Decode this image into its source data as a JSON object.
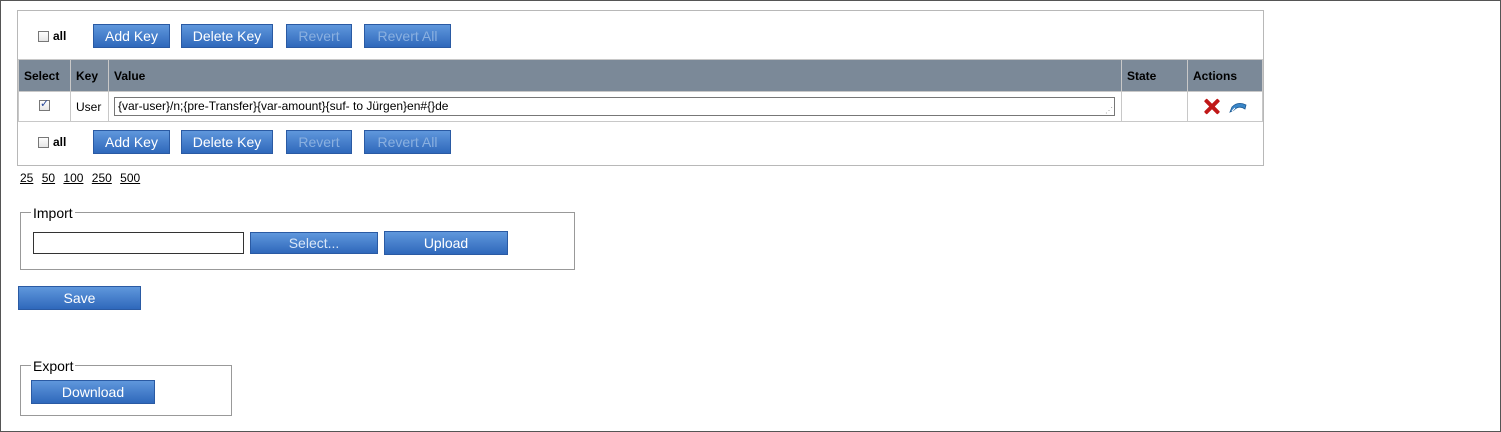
{
  "toolbar": {
    "all_label": "all",
    "add_key": "Add Key",
    "delete_key": "Delete Key",
    "revert": "Revert",
    "revert_all": "Revert All"
  },
  "table": {
    "headers": {
      "select": "Select",
      "key": "Key",
      "value": "Value",
      "state": "State",
      "actions": "Actions"
    },
    "rows": [
      {
        "checked": true,
        "key": "User",
        "value": "{var-user}/n;{pre-Transfer}{var-amount}{suf- to Jürgen}en#{}de",
        "state": ""
      }
    ]
  },
  "pager": {
    "sizes": [
      "25",
      "50",
      "100",
      "250",
      "500"
    ]
  },
  "import": {
    "legend": "Import",
    "file_value": "",
    "select_label": "Select...",
    "upload_label": "Upload"
  },
  "save_label": "Save",
  "export": {
    "legend": "Export",
    "download_label": "Download"
  },
  "colors": {
    "button_top": "#5f97dc",
    "button_bottom": "#2f68bb",
    "header_bg": "#7b8998",
    "delete_icon": "#c01818",
    "edit_icon": "#3a86c8"
  }
}
